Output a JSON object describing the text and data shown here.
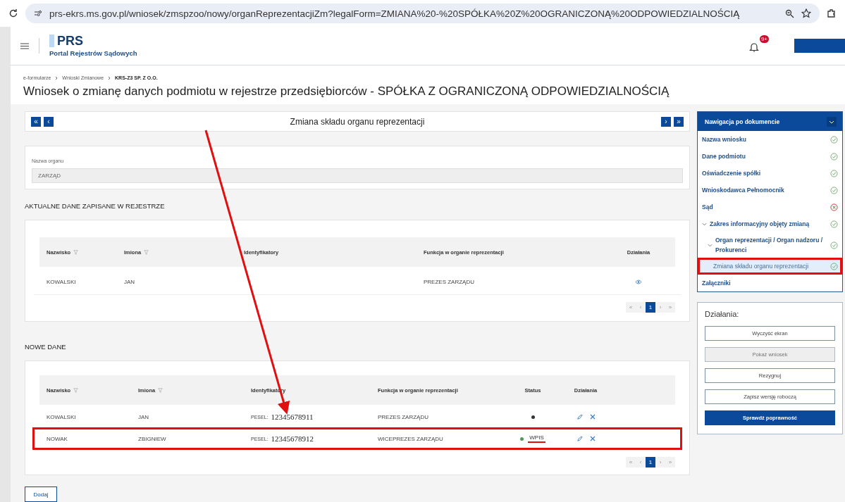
{
  "browser": {
    "url": "prs-ekrs.ms.gov.pl/wniosek/zmspzoo/nowy/organReprezentacjiZm?legalForm=ZMIANA%20-%20SPÓŁKA%20Z%20OGRANICZONĄ%20ODPOWIEDZIALNOŚCIĄ"
  },
  "header": {
    "logo_title": "PRS",
    "logo_subtitle": "Portal Rejestrów Sądowych",
    "notification_badge": "9+"
  },
  "breadcrumbs": [
    "e-formularze",
    "Wnioski Zmianowe",
    "KRS-Z3 SP. Z O.O."
  ],
  "page_title": "Wniosek o zmianę danych podmiotu w rejestrze przedsiębiorców - SPÓŁKA Z OGRANICZONĄ ODPOWIEDZIALNOŚCIĄ",
  "step_bar": {
    "title": "Zmiana składu organu reprezentacji",
    "prev_buttons": [
      "«",
      "‹"
    ],
    "next_buttons": [
      "›",
      "»"
    ]
  },
  "organ": {
    "label": "Nazwa organu",
    "value": "ZARZĄD"
  },
  "current": {
    "heading": "AKTUALNE DANE ZAPISANE W REJESTRZE",
    "columns": [
      {
        "label": "Nazwisko",
        "filter": true
      },
      {
        "label": "Imiona",
        "filter": true
      },
      {
        "label": "Identyfikatory",
        "filter": false
      },
      {
        "label": "Funkcja w organie reprezentacji",
        "filter": false
      },
      {
        "label": "Działania",
        "filter": false
      }
    ],
    "rows": [
      {
        "surname": "KOWALSKI",
        "names": "JAN",
        "function": "PREZES ZARZĄDU"
      }
    ],
    "pagination": [
      "«",
      "‹",
      "1",
      "›",
      "»"
    ]
  },
  "new": {
    "heading": "NOWE DANE",
    "columns": [
      {
        "label": "Nazwisko",
        "filter": true
      },
      {
        "label": "Imiona",
        "filter": true
      },
      {
        "label": "Identyfikatory",
        "filter": false
      },
      {
        "label": "Funkcja w organie reprezentacji",
        "filter": false
      },
      {
        "label": "Status",
        "filter": false
      },
      {
        "label": "Działania",
        "filter": false
      }
    ],
    "rows": [
      {
        "surname": "KOWALSKI",
        "names": "JAN",
        "id_label": "PESEL:",
        "id_value": "12345678911",
        "function": "PREZES ZARZĄDU",
        "color": "#333333",
        "highlighted": false
      },
      {
        "surname": "NOWAK",
        "names": "ZBIGNIEW",
        "id_label": "PESEL:",
        "id_value": "12345678912",
        "function": "WICEPREZES ZARZĄDU",
        "color": "#4a9a5a",
        "status_text": "WPIS",
        "highlighted": true
      }
    ],
    "pagination": [
      "«",
      "‹",
      "1",
      "›",
      "»"
    ],
    "add_button": "Dodaj"
  },
  "navigation": {
    "title": "Nawigacja po dokumencie",
    "items": [
      {
        "label": "Nazwa wniosku",
        "valid": true,
        "selected": false
      },
      {
        "label": "Dane podmiotu",
        "valid": true,
        "selected": false
      },
      {
        "label": "Oświadczenie spółki",
        "valid": true,
        "selected": false
      },
      {
        "label": "Wnioskodawca Pełnomocnik",
        "valid": true,
        "selected": false
      },
      {
        "label": "Sąd",
        "valid": false,
        "selected": false
      },
      {
        "label": "Zakres informacyjny objęty zmianą",
        "valid": true,
        "selected": false,
        "expanded": true,
        "children": [
          {
            "label": "Organ reprezentacji / Organ nadzoru / Prokurenci",
            "valid": true,
            "selected": false,
            "expanded": true,
            "children": [
              {
                "label": "Zmiana składu organu reprezentacji",
                "valid": true,
                "selected": true,
                "highlighted": true
              }
            ]
          }
        ]
      },
      {
        "label": "Załączniki",
        "selected": false
      }
    ]
  },
  "actions": {
    "title": "Działania:",
    "buttons": [
      {
        "label": "Wyczyść ekran",
        "kind": "outline",
        "disabled": false
      },
      {
        "label": "Pokaż wniosek",
        "kind": "outline",
        "disabled": true
      },
      {
        "label": "Rezygnuj",
        "kind": "outline",
        "disabled": false
      },
      {
        "label": "Zapisz wersję roboczą",
        "kind": "outline",
        "disabled": false
      },
      {
        "label": "Sprawdź poprawność",
        "kind": "primary",
        "disabled": false
      }
    ]
  }
}
